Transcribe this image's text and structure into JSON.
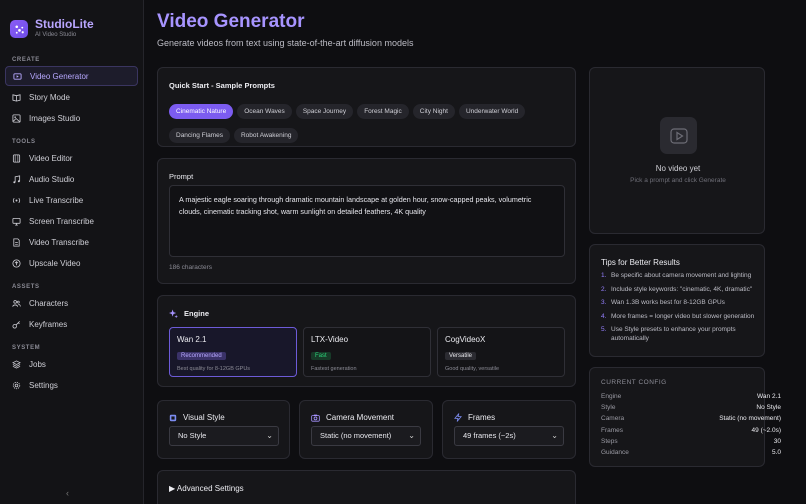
{
  "app": {
    "name": "StudioLite",
    "tagline": "AI Video Studio"
  },
  "sidebar": {
    "sections": [
      {
        "label": "CREATE",
        "items": [
          {
            "label": "Video Generator",
            "icon": "video-icon",
            "active": true
          },
          {
            "label": "Story Mode",
            "icon": "book-icon"
          },
          {
            "label": "Images Studio",
            "icon": "image-icon"
          }
        ]
      },
      {
        "label": "TOOLS",
        "items": [
          {
            "label": "Video Editor",
            "icon": "film-icon"
          },
          {
            "label": "Audio Studio",
            "icon": "music-icon"
          },
          {
            "label": "Live Transcribe",
            "icon": "broadcast-icon"
          },
          {
            "label": "Screen Transcribe",
            "icon": "monitor-icon"
          },
          {
            "label": "Video Transcribe",
            "icon": "document-icon"
          },
          {
            "label": "Upscale Video",
            "icon": "upscale-icon"
          }
        ]
      },
      {
        "label": "ASSETS",
        "items": [
          {
            "label": "Characters",
            "icon": "users-icon"
          },
          {
            "label": "Keyframes",
            "icon": "key-icon"
          }
        ]
      },
      {
        "label": "SYSTEM",
        "items": [
          {
            "label": "Jobs",
            "icon": "layers-icon"
          },
          {
            "label": "Settings",
            "icon": "gear-icon"
          }
        ]
      }
    ],
    "collapse_glyph": "‹"
  },
  "page": {
    "title": "Video Generator",
    "subtitle": "Generate videos from text using state-of-the-art diffusion models"
  },
  "quick_start": {
    "title": "Quick Start - Sample Prompts",
    "prompts": [
      "Cinematic Nature",
      "Ocean Waves",
      "Space Journey",
      "Forest Magic",
      "City Night",
      "Underwater World",
      "Dancing Flames",
      "Robot Awakening"
    ],
    "active_index": 0
  },
  "prompt": {
    "label": "Prompt",
    "value": "A majestic eagle soaring through dramatic mountain landscape at golden hour, snow-capped peaks, volumetric clouds, cinematic tracking shot, warm sunlight on detailed feathers, 4K quality",
    "char_count": "186 characters"
  },
  "engine": {
    "title": "Engine",
    "options": [
      {
        "name": "Wan 2.1",
        "badge": "Recommended",
        "desc": "Best quality for 8-12GB GPUs",
        "selected": true
      },
      {
        "name": "LTX-Video",
        "badge": "Fast",
        "desc": "Fastest generation"
      },
      {
        "name": "CogVideoX",
        "badge": "Versatile",
        "desc": "Good quality, versatile"
      }
    ]
  },
  "visual_style": {
    "title": "Visual Style",
    "value": "No Style"
  },
  "camera_movement": {
    "title": "Camera Movement",
    "value": "Static (no movement)"
  },
  "frames": {
    "title": "Frames",
    "value": "49 frames (~2s)"
  },
  "advanced": {
    "label": "▶ Advanced Settings"
  },
  "preview": {
    "title": "No video yet",
    "hint": "Pick a prompt and click Generate"
  },
  "tips": {
    "title": "Tips for Better Results",
    "items": [
      "Be specific about camera movement and lighting",
      "Include style keywords: \"cinematic, 4K, dramatic\"",
      "Wan 1.3B works best for 8-12GB GPUs",
      "More frames = longer video but slower generation",
      "Use Style presets to enhance your prompts automatically"
    ]
  },
  "config": {
    "title": "CURRENT CONFIG",
    "rows": [
      {
        "k": "Engine",
        "v": "Wan 2.1"
      },
      {
        "k": "Style",
        "v": "No Style"
      },
      {
        "k": "Camera",
        "v": "Static (no movement)"
      },
      {
        "k": "Frames",
        "v": "49 (~2.0s)"
      },
      {
        "k": "Steps",
        "v": "30"
      },
      {
        "k": "Guidance",
        "v": "5.0"
      }
    ]
  },
  "colors": {
    "accent": "#7c5cf0",
    "accent_text": "#a794ff",
    "badge_green": "#2dd47a"
  }
}
